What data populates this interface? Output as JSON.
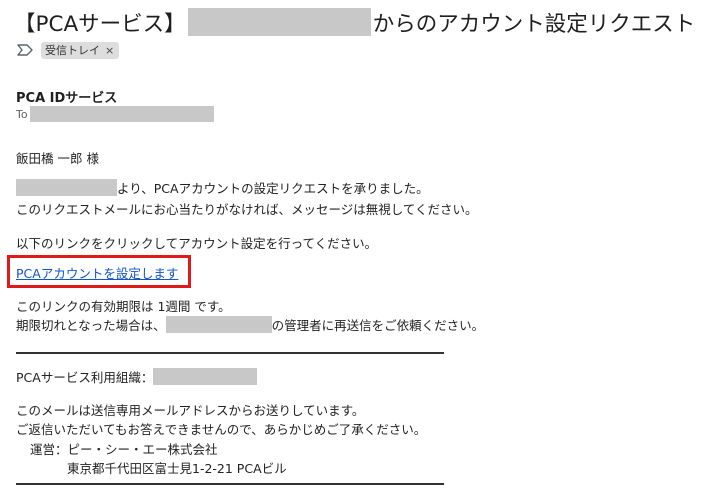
{
  "email": {
    "subject_prefix": "【PCAサービス】",
    "subject_suffix": "からのアカウント設定リクエスト",
    "label": "受信トレイ",
    "label_close": "×",
    "sender": "PCA IDサービス",
    "to_label": "To",
    "greeting": "飯田橋 一郎 様",
    "body_line1_suffix": " より、PCAアカウントの設定リクエストを承りました。",
    "body_line2": "このリクエストメールにお心当たりがなければ、メッセージは無視してください。",
    "body_line3": "以下のリンクをクリックしてアカウント設定を行ってください。",
    "link_text": "PCAアカウントを設定します",
    "validity": "このリンクの有効期限は 1週間 です。",
    "expired_prefix": "期限切れとなった場合は、",
    "expired_suffix": "の管理者に再送信をご依頼ください。",
    "org_label": "PCAサービス利用組織：",
    "footer_line1": "このメールは送信専用メールアドレスからお送りしています。",
    "footer_line2": "ご返信いただいてもお答えできませんので、あらかじめご了承ください。",
    "operator": "運営：ピー・シー・エー株式会社",
    "address": "東京都千代田区富士見1-2-21 PCAビル"
  },
  "colors": {
    "link": "#1155cc",
    "highlight_border": "#e01919",
    "redaction": "#c8c8c8"
  },
  "icons": {
    "label_marker": "label-arrow-icon"
  }
}
